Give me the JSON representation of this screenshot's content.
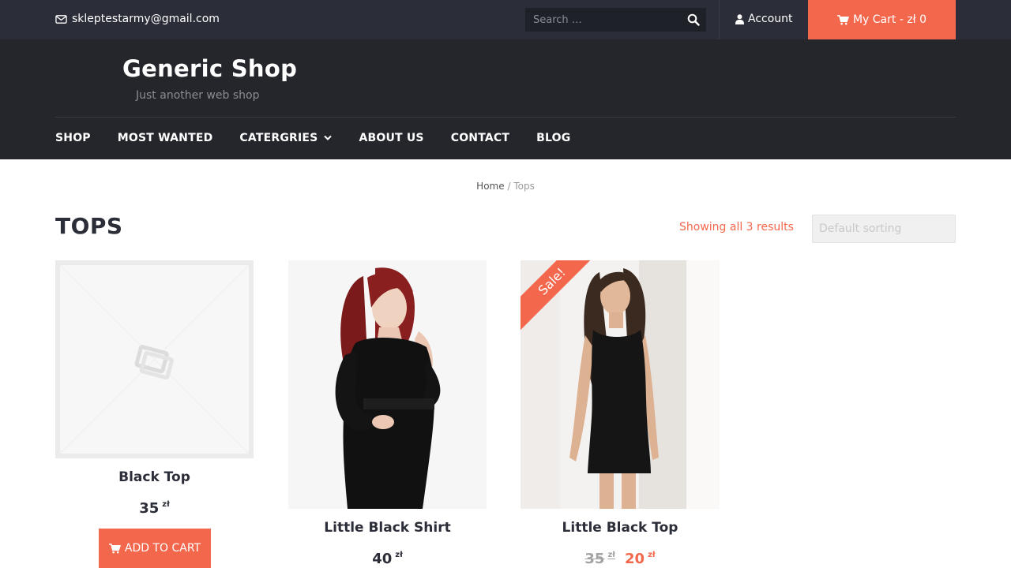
{
  "topbar": {
    "email": "skleptestarmy@gmail.com",
    "search_placeholder": "Search …",
    "account_label": "Account",
    "cart_label": "My Cart - zł 0"
  },
  "header": {
    "site_title": "Generic Shop",
    "site_description": "Just another web shop"
  },
  "nav": {
    "items": [
      "SHOP",
      "MOST WANTED",
      "CATERGRIES",
      "ABOUT US",
      "CONTACT",
      "BLOG"
    ]
  },
  "breadcrumb": {
    "home": "Home",
    "separator": "/",
    "current": "Tops"
  },
  "main": {
    "page_title": "TOPS",
    "result_count": "Showing all 3 results",
    "sorting_selected": "Default sorting"
  },
  "products": [
    {
      "name": "Black Top",
      "price": "35",
      "currency": "zł",
      "button": "ADD TO CART",
      "image": "placeholder-icon"
    },
    {
      "name": "Little Black Shirt",
      "price": "40",
      "currency": "zł",
      "image": "woman-red-hair-black-shirt"
    },
    {
      "name": "Little Black Top",
      "old_price": "35",
      "price": "20",
      "currency": "zł",
      "badge": "Sale!",
      "image": "woman-black-dress"
    }
  ],
  "colors": {
    "accent": "#f3674c",
    "topbar_bg": "#2b2e38",
    "header_bg": "#24262c",
    "text_dark": "#2b2e38"
  }
}
